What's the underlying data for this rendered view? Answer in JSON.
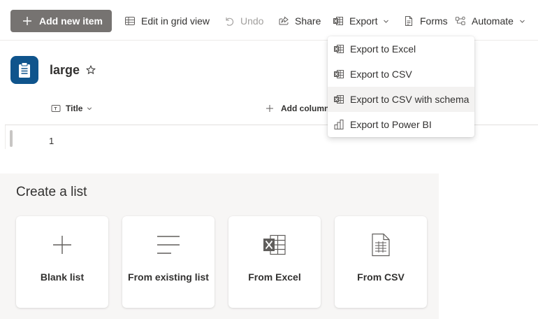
{
  "toolbar": {
    "add_new_item": "Add new item",
    "edit_grid": "Edit in grid view",
    "undo": "Undo",
    "share": "Share",
    "export": "Export",
    "forms": "Forms",
    "automate": "Automate"
  },
  "list": {
    "title": "large",
    "column_title": "Title",
    "add_column": "Add column",
    "rows": [
      "1"
    ]
  },
  "export_menu": {
    "items": [
      {
        "label": "Export to Excel",
        "icon": "excel-icon"
      },
      {
        "label": "Export to CSV",
        "icon": "excel-icon"
      },
      {
        "label": "Export to CSV with schema",
        "icon": "excel-icon"
      },
      {
        "label": "Export to Power BI",
        "icon": "powerbi-icon"
      }
    ],
    "highlighted_index": 2
  },
  "create_list": {
    "title": "Create a list",
    "cards": [
      {
        "label": "Blank list",
        "icon": "plus-icon"
      },
      {
        "label": "From existing list",
        "icon": "lines-icon"
      },
      {
        "label": "From Excel",
        "icon": "excel-icon"
      },
      {
        "label": "From CSV",
        "icon": "csv-file-icon"
      }
    ]
  },
  "colors": {
    "primary_button": "#767371",
    "list_icon_bg": "#0f548c",
    "menu_hover": "#f3f2f1",
    "panel_bg": "#f7f6f5"
  }
}
